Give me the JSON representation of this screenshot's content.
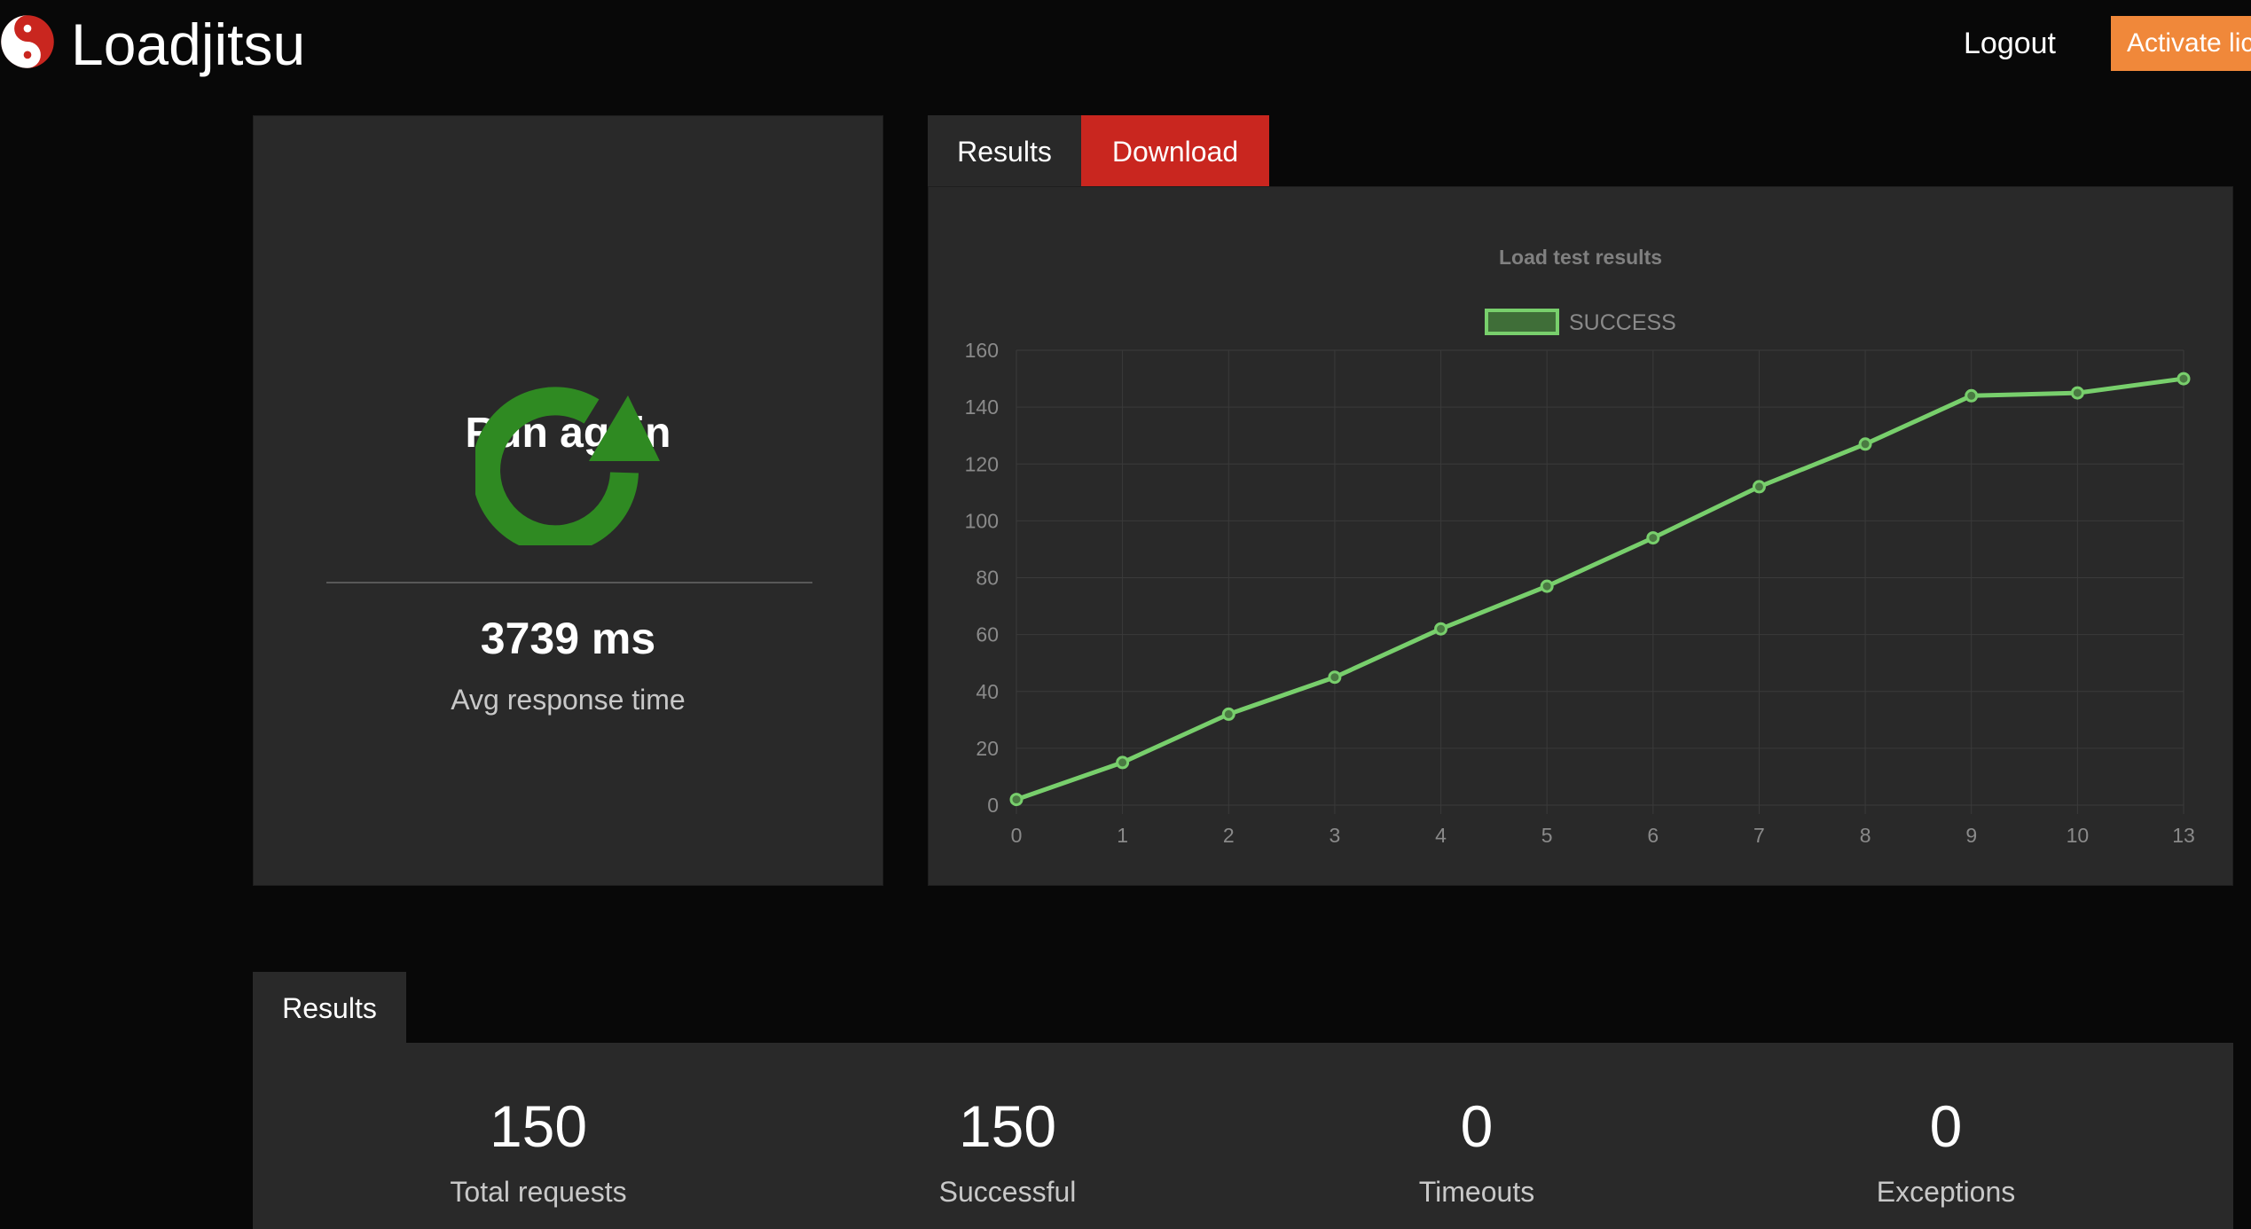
{
  "app": {
    "brand": "Loadjitsu",
    "logo_icon": "yin-yang-icon"
  },
  "nav": {
    "logout_label": "Logout",
    "activate_label": "Activate lic"
  },
  "run_panel": {
    "title": "Run again",
    "icon": "reload-icon",
    "avg_response": "3739 ms",
    "avg_label": "Avg response time"
  },
  "chart_tabs": {
    "results_label": "Results",
    "download_label": "Download"
  },
  "chart_data": {
    "type": "line",
    "title": "Load test results",
    "x": [
      "0",
      "1",
      "2",
      "3",
      "4",
      "5",
      "6",
      "7",
      "8",
      "9",
      "10",
      "13"
    ],
    "series": [
      {
        "name": "SUCCESS",
        "values": [
          2,
          15,
          32,
          45,
          62,
          77,
          94,
          112,
          127,
          144,
          145,
          150
        ]
      }
    ],
    "ylim": [
      0,
      160
    ],
    "yticks": [
      0,
      20,
      40,
      60,
      80,
      100,
      120,
      140,
      160
    ],
    "grid": true,
    "legend": "top-center",
    "color": "#78cf6c"
  },
  "results_tab": {
    "label": "Results"
  },
  "stats": [
    {
      "value": "150",
      "label": "Total requests"
    },
    {
      "value": "150",
      "label": "Successful"
    },
    {
      "value": "0",
      "label": "Timeouts"
    },
    {
      "value": "0",
      "label": "Exceptions"
    }
  ],
  "colors": {
    "background": "#080808",
    "panel": "#292929",
    "download": "#c9261f",
    "activate": "#f0883a",
    "reload_icon": "#2f8a22"
  }
}
